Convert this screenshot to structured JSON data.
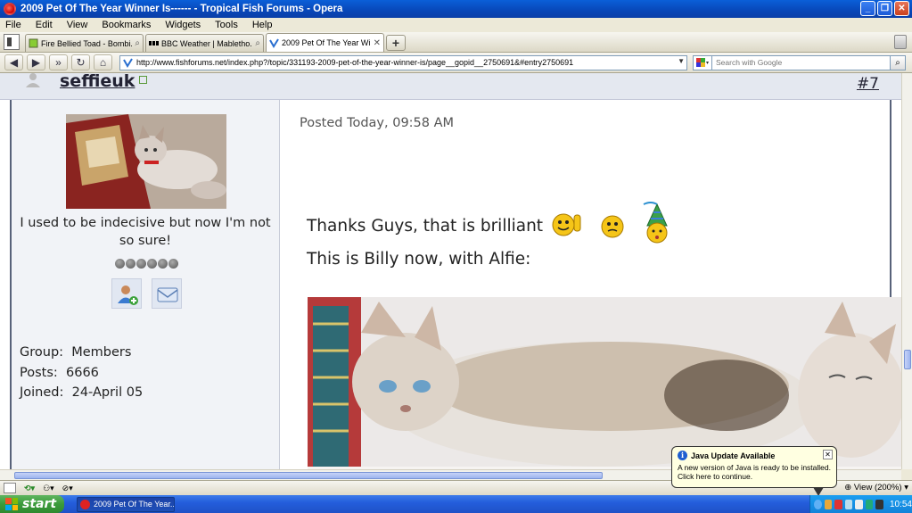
{
  "window": {
    "title": "2009 Pet Of The Year Winner Is------ - Tropical Fish Forums - Opera"
  },
  "menu": [
    "File",
    "Edit",
    "View",
    "Bookmarks",
    "Widgets",
    "Tools",
    "Help"
  ],
  "tabs": [
    {
      "label": "Fire Bellied Toad - Bombi..."
    },
    {
      "label": "BBC Weather | Mabletho..."
    },
    {
      "label": "2009 Pet Of The Year Wi..."
    }
  ],
  "address": {
    "url": "http://www.fishforums.net/index.php?/topic/331193-2009-pet-of-the-year-winner-is/page__gopid__2750691&#entry2750691",
    "search_placeholder": "Search with Google"
  },
  "post": {
    "username": "seffieuk",
    "number": "#7",
    "posted": "Posted Today, 09:58 AM",
    "line1": "Thanks Guys, that is brilliant",
    "line2": "This is Billy now, with Alfie:"
  },
  "profile": {
    "signature": "I used to be indecisive but now I'm not so sure!",
    "group_label": "Group:",
    "group": "Members",
    "posts_label": "Posts:",
    "posts": "6666",
    "joined_label": "Joined:",
    "joined": "24-April 05",
    "rank_pips": 6
  },
  "status": {
    "zoom": "View (200%)"
  },
  "balloon": {
    "title": "Java Update Available",
    "line1": "A new version of Java is ready to be installed.",
    "line2": "Click here to continue."
  },
  "taskbar": {
    "start": "start",
    "item": "2009 Pet Of The Year...",
    "clock": "10:54"
  },
  "colors": {
    "titlebar": "#0a5fd8",
    "taskbar": "#245edc",
    "start": "#3b9a3b"
  }
}
